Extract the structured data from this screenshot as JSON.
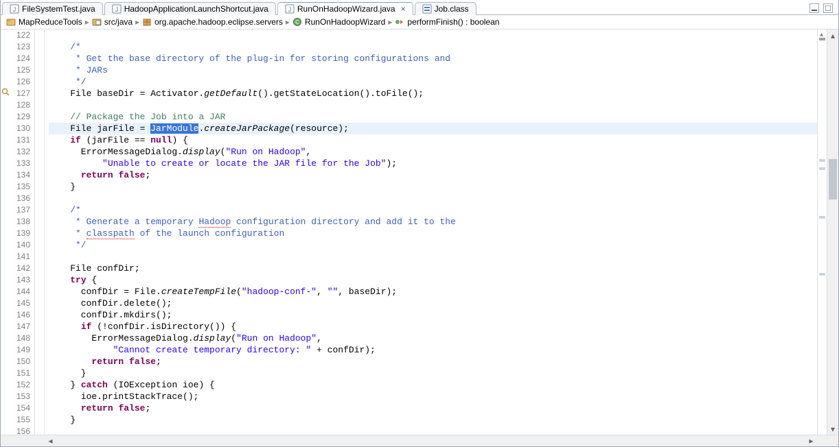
{
  "tabs": [
    {
      "label": "FileSystemTest.java",
      "icon": "java-file-icon",
      "active": false
    },
    {
      "label": "HadoopApplicationLaunchShortcut.java",
      "icon": "java-file-icon",
      "active": false
    },
    {
      "label": "RunOnHadoopWizard.java",
      "icon": "java-file-icon",
      "active": true
    },
    {
      "label": "Job.class",
      "icon": "class-file-icon",
      "active": false
    }
  ],
  "breadcrumb": [
    {
      "label": "MapReduceTools",
      "icon": "project-icon"
    },
    {
      "label": "src/java",
      "icon": "source-folder-icon"
    },
    {
      "label": "org.apache.hadoop.eclipse.servers",
      "icon": "package-icon"
    },
    {
      "label": "RunOnHadoopWizard",
      "icon": "class-icon"
    },
    {
      "label": "performFinish() : boolean",
      "icon": "method-icon"
    }
  ],
  "highlighted_line_index": 8,
  "selected_token": "JarModule",
  "search_marker_line_index": 5,
  "lines": [
    {
      "num": 122,
      "tokens": []
    },
    {
      "num": 123,
      "tokens": [
        {
          "t": "    ",
          "c": ""
        },
        {
          "t": "/*",
          "c": "c-doc"
        }
      ]
    },
    {
      "num": 124,
      "tokens": [
        {
          "t": "     * Get the base directory of the plug-in for storing configurations and",
          "c": "c-doc"
        }
      ]
    },
    {
      "num": 125,
      "tokens": [
        {
          "t": "     * JARs",
          "c": "c-doc"
        }
      ]
    },
    {
      "num": 126,
      "tokens": [
        {
          "t": "     */",
          "c": "c-doc"
        }
      ]
    },
    {
      "num": 127,
      "tokens": [
        {
          "t": "    File baseDir = Activator.",
          "c": ""
        },
        {
          "t": "getDefault",
          "c": "c-ital"
        },
        {
          "t": "().getStateLocation().toFile();",
          "c": ""
        }
      ]
    },
    {
      "num": 128,
      "tokens": []
    },
    {
      "num": 129,
      "tokens": [
        {
          "t": "    ",
          "c": ""
        },
        {
          "t": "// Package the Job into a JAR",
          "c": "c-comment"
        }
      ]
    },
    {
      "num": 130,
      "tokens": [
        {
          "t": "    File jarFile = ",
          "c": ""
        },
        {
          "t": "JarModule",
          "c": "c-sel"
        },
        {
          "t": ".",
          "c": ""
        },
        {
          "t": "createJarPackage",
          "c": "c-ital"
        },
        {
          "t": "(resource);",
          "c": ""
        }
      ]
    },
    {
      "num": 131,
      "tokens": [
        {
          "t": "    ",
          "c": ""
        },
        {
          "t": "if",
          "c": "c-kw"
        },
        {
          "t": " (jarFile == ",
          "c": ""
        },
        {
          "t": "null",
          "c": "c-kw"
        },
        {
          "t": ") {",
          "c": ""
        }
      ]
    },
    {
      "num": 132,
      "tokens": [
        {
          "t": "      ErrorMessageDialog.",
          "c": ""
        },
        {
          "t": "display",
          "c": "c-ital"
        },
        {
          "t": "(",
          "c": ""
        },
        {
          "t": "\"Run on Hadoop\"",
          "c": "c-str"
        },
        {
          "t": ",",
          "c": ""
        }
      ]
    },
    {
      "num": 133,
      "tokens": [
        {
          "t": "          ",
          "c": ""
        },
        {
          "t": "\"Unable to create or locate the JAR file for the Job\"",
          "c": "c-str"
        },
        {
          "t": ");",
          "c": ""
        }
      ]
    },
    {
      "num": 134,
      "tokens": [
        {
          "t": "      ",
          "c": ""
        },
        {
          "t": "return",
          "c": "c-kw"
        },
        {
          "t": " ",
          "c": ""
        },
        {
          "t": "false",
          "c": "c-kw"
        },
        {
          "t": ";",
          "c": ""
        }
      ]
    },
    {
      "num": 135,
      "tokens": [
        {
          "t": "    }",
          "c": ""
        }
      ]
    },
    {
      "num": 136,
      "tokens": []
    },
    {
      "num": 137,
      "tokens": [
        {
          "t": "    ",
          "c": ""
        },
        {
          "t": "/*",
          "c": "c-doc"
        }
      ]
    },
    {
      "num": 138,
      "tokens": [
        {
          "t": "     * Generate a temporary ",
          "c": "c-doc"
        },
        {
          "t": "Hadoop",
          "c": "c-doc c-wavy"
        },
        {
          "t": " configuration directory and add it to the",
          "c": "c-doc"
        }
      ]
    },
    {
      "num": 139,
      "tokens": [
        {
          "t": "     * ",
          "c": "c-doc"
        },
        {
          "t": "classpath",
          "c": "c-doc c-wavy"
        },
        {
          "t": " of the launch configuration",
          "c": "c-doc"
        }
      ]
    },
    {
      "num": 140,
      "tokens": [
        {
          "t": "     */",
          "c": "c-doc"
        }
      ]
    },
    {
      "num": 141,
      "tokens": []
    },
    {
      "num": 142,
      "tokens": [
        {
          "t": "    File confDir;",
          "c": ""
        }
      ]
    },
    {
      "num": 143,
      "tokens": [
        {
          "t": "    ",
          "c": ""
        },
        {
          "t": "try",
          "c": "c-kw"
        },
        {
          "t": " {",
          "c": ""
        }
      ]
    },
    {
      "num": 144,
      "tokens": [
        {
          "t": "      confDir = File.",
          "c": ""
        },
        {
          "t": "createTempFile",
          "c": "c-ital"
        },
        {
          "t": "(",
          "c": ""
        },
        {
          "t": "\"hadoop-conf-\"",
          "c": "c-str"
        },
        {
          "t": ", ",
          "c": ""
        },
        {
          "t": "\"\"",
          "c": "c-str"
        },
        {
          "t": ", baseDir);",
          "c": ""
        }
      ]
    },
    {
      "num": 145,
      "tokens": [
        {
          "t": "      confDir.delete();",
          "c": ""
        }
      ]
    },
    {
      "num": 146,
      "tokens": [
        {
          "t": "      confDir.mkdirs();",
          "c": ""
        }
      ]
    },
    {
      "num": 147,
      "tokens": [
        {
          "t": "      ",
          "c": ""
        },
        {
          "t": "if",
          "c": "c-kw"
        },
        {
          "t": " (!confDir.isDirectory()) {",
          "c": ""
        }
      ]
    },
    {
      "num": 148,
      "tokens": [
        {
          "t": "        ErrorMessageDialog.",
          "c": ""
        },
        {
          "t": "display",
          "c": "c-ital"
        },
        {
          "t": "(",
          "c": ""
        },
        {
          "t": "\"Run on Hadoop\"",
          "c": "c-str"
        },
        {
          "t": ",",
          "c": ""
        }
      ]
    },
    {
      "num": 149,
      "tokens": [
        {
          "t": "            ",
          "c": ""
        },
        {
          "t": "\"Cannot create temporary directory: \"",
          "c": "c-str"
        },
        {
          "t": " + confDir);",
          "c": ""
        }
      ]
    },
    {
      "num": 150,
      "tokens": [
        {
          "t": "        ",
          "c": ""
        },
        {
          "t": "return",
          "c": "c-kw"
        },
        {
          "t": " ",
          "c": ""
        },
        {
          "t": "false",
          "c": "c-kw"
        },
        {
          "t": ";",
          "c": ""
        }
      ]
    },
    {
      "num": 151,
      "tokens": [
        {
          "t": "      }",
          "c": ""
        }
      ]
    },
    {
      "num": 152,
      "tokens": [
        {
          "t": "    } ",
          "c": ""
        },
        {
          "t": "catch",
          "c": "c-kw"
        },
        {
          "t": " (IOException ioe) {",
          "c": ""
        }
      ]
    },
    {
      "num": 153,
      "tokens": [
        {
          "t": "      ioe.printStackTrace();",
          "c": ""
        }
      ]
    },
    {
      "num": 154,
      "tokens": [
        {
          "t": "      ",
          "c": ""
        },
        {
          "t": "return",
          "c": "c-kw"
        },
        {
          "t": " ",
          "c": ""
        },
        {
          "t": "false",
          "c": "c-kw"
        },
        {
          "t": ";",
          "c": ""
        }
      ]
    },
    {
      "num": 155,
      "tokens": [
        {
          "t": "    }",
          "c": ""
        }
      ]
    },
    {
      "num": 156,
      "tokens": []
    }
  ],
  "vscroll": {
    "thumb_top_pct": 32,
    "thumb_height_pct": 10
  },
  "overview_marks": [
    {
      "top_pct": 2,
      "color": "#9aa0a6"
    },
    {
      "top_pct": 32,
      "color": "#c9d4e3"
    },
    {
      "top_pct": 34,
      "color": "#c9d4e3"
    },
    {
      "top_pct": 46,
      "color": "#c9d4e3"
    },
    {
      "top_pct": 60,
      "color": "#c9d4e3"
    }
  ]
}
